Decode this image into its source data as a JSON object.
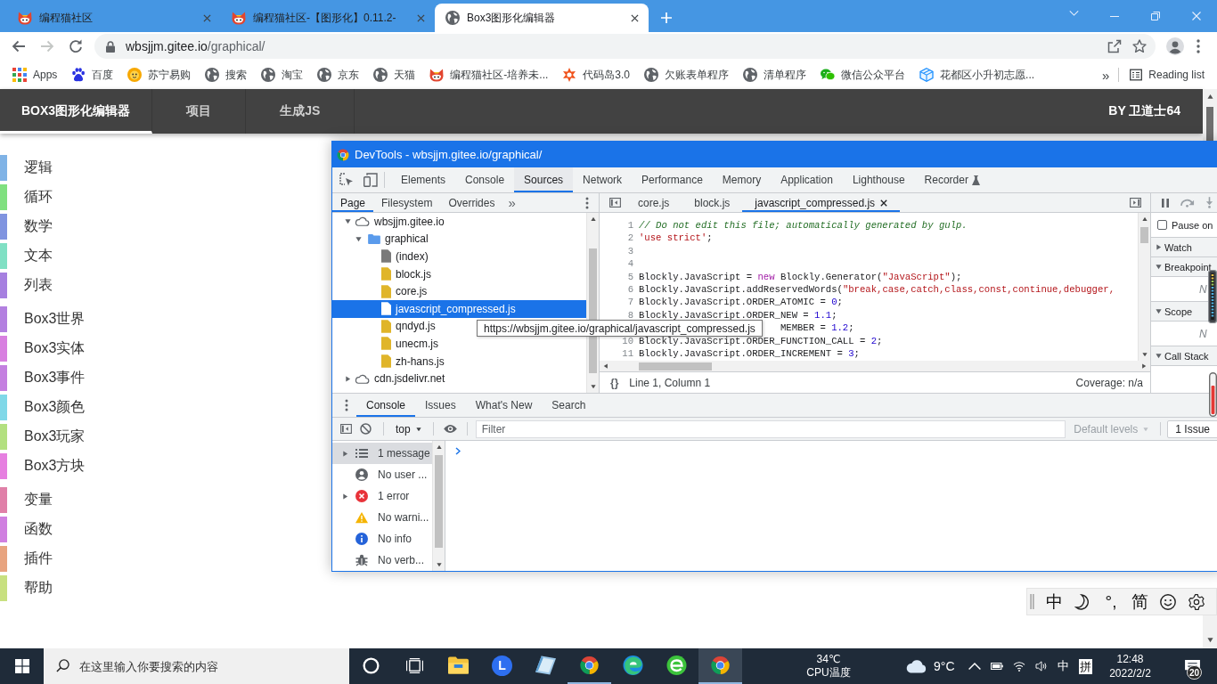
{
  "browser": {
    "tabs": [
      {
        "title": "编程猫社区",
        "kind": "cat",
        "selected": false
      },
      {
        "title": "编程猫社区-【图形化】0.11.2-",
        "kind": "cat",
        "selected": false
      },
      {
        "title": "Box3图形化编辑器",
        "kind": "globe",
        "selected": true
      }
    ],
    "forward_disabled": true,
    "url": {
      "host": "wbsjjm.gitee.io",
      "path": "/graphical/"
    },
    "bookmarks": [
      {
        "label": "Apps",
        "kind": "apps"
      },
      {
        "label": "百度",
        "kind": "paw"
      },
      {
        "label": "苏宁易购",
        "kind": "sun"
      },
      {
        "label": "搜索",
        "kind": "globe"
      },
      {
        "label": "淘宝",
        "kind": "globe"
      },
      {
        "label": "京东",
        "kind": "globe"
      },
      {
        "label": "天猫",
        "kind": "globe"
      },
      {
        "label": "编程猫社区-培养未...",
        "kind": "cat"
      },
      {
        "label": "代码岛3.0",
        "kind": "flower"
      },
      {
        "label": "欠账表单程序",
        "kind": "globe"
      },
      {
        "label": "清单程序",
        "kind": "globe"
      },
      {
        "label": "微信公众平台",
        "kind": "chat"
      },
      {
        "label": "花都区小升初志愿...",
        "kind": "cube"
      }
    ],
    "bookmarks_more": "»",
    "reading_list": "Reading list"
  },
  "page": {
    "nav": [
      {
        "label": "BOX3图形化编辑器",
        "selected": true
      },
      {
        "label": "项目",
        "selected": false
      },
      {
        "label": "生成JS",
        "selected": false
      }
    ],
    "author": "BY 卫道士64",
    "category_groups": [
      {
        "items": [
          {
            "label": "逻辑",
            "color": "#80b3e6"
          },
          {
            "label": "循环",
            "color": "#80e080"
          },
          {
            "label": "数学",
            "color": "#8094e0"
          },
          {
            "label": "文本",
            "color": "#80e0c4"
          },
          {
            "label": "列表",
            "color": "#a680e0"
          }
        ]
      },
      {
        "items": [
          {
            "label": "Box3世界",
            "color": "#b380e0"
          },
          {
            "label": "Box3实体",
            "color": "#d880e0"
          },
          {
            "label": "Box3事件",
            "color": "#c480e0"
          },
          {
            "label": "Box3颜色",
            "color": "#80d8e8"
          },
          {
            "label": "Box3玩家",
            "color": "#b3e080"
          },
          {
            "label": "Box3方块",
            "color": "#e680e0"
          }
        ]
      },
      {
        "items": [
          {
            "label": "变量",
            "color": "#e080a8"
          },
          {
            "label": "函数",
            "color": "#d080e0"
          },
          {
            "label": "插件",
            "color": "#e8a480"
          },
          {
            "label": "帮助",
            "color": "#c8e080"
          }
        ]
      }
    ]
  },
  "devtools": {
    "title": "DevTools - wbsjjm.gitee.io/graphical/",
    "panels": [
      {
        "label": "Elements",
        "selected": false,
        "experimental": false
      },
      {
        "label": "Console",
        "selected": false,
        "experimental": false
      },
      {
        "label": "Sources",
        "selected": true,
        "experimental": false
      },
      {
        "label": "Network",
        "selected": false,
        "experimental": false
      },
      {
        "label": "Performance",
        "selected": false,
        "experimental": false
      },
      {
        "label": "Memory",
        "selected": false,
        "experimental": false
      },
      {
        "label": "Application",
        "selected": false,
        "experimental": false
      },
      {
        "label": "Lighthouse",
        "selected": false,
        "experimental": false
      },
      {
        "label": "Recorder",
        "selected": false,
        "experimental": true
      }
    ],
    "navigator": {
      "tabs": [
        {
          "label": "Page",
          "selected": true
        },
        {
          "label": "Filesystem",
          "selected": false
        },
        {
          "label": "Overrides",
          "selected": false
        }
      ],
      "more": "»",
      "tree": [
        {
          "label": "wbsjjm.gitee.io",
          "kind": "domain",
          "expanded": true,
          "selected": false,
          "children": [
            {
              "label": "graphical",
              "kind": "folder",
              "expanded": true,
              "selected": false,
              "children": [
                {
                  "label": "(index)",
                  "kind": "document",
                  "selected": false
                },
                {
                  "label": "block.js",
                  "kind": "script",
                  "selected": false
                },
                {
                  "label": "core.js",
                  "kind": "script",
                  "selected": false
                },
                {
                  "label": "javascript_compressed.js",
                  "kind": "script",
                  "selected": true
                },
                {
                  "label": "qndyd.js",
                  "kind": "script",
                  "selected": false
                },
                {
                  "label": "unecm.js",
                  "kind": "script",
                  "selected": false
                },
                {
                  "label": "zh-hans.js",
                  "kind": "script",
                  "selected": false
                }
              ]
            }
          ]
        },
        {
          "label": "cdn.jsdelivr.net",
          "kind": "domain",
          "expanded": false,
          "selected": false
        }
      ],
      "tooltip": "https://wbsjjm.gitee.io/graphical/javascript_compressed.js"
    },
    "editor": {
      "tabs": [
        {
          "label": "core.js",
          "selected": false
        },
        {
          "label": "block.js",
          "selected": false
        },
        {
          "label": "javascript_compressed.js",
          "selected": true
        }
      ],
      "lines": [
        {
          "n": "1",
          "covered": false,
          "tokens": [
            {
              "kind": "comment",
              "text": "// Do not edit this file; automatically generated by gulp."
            }
          ]
        },
        {
          "n": "2",
          "covered": false,
          "tokens": [
            {
              "kind": "string",
              "text": "'use strict'"
            },
            {
              "kind": "plain",
              "text": ";"
            }
          ]
        },
        {
          "n": "3"
        },
        {
          "n": "4"
        },
        {
          "n": "5",
          "covered": false,
          "tokens": [
            {
              "kind": "plain",
              "text": "Blockly.JavaScript = "
            },
            {
              "kind": "keyword",
              "text": "new"
            },
            {
              "kind": "plain",
              "text": " Blockly.Generator("
            },
            {
              "kind": "string",
              "text": "\"JavaScript\""
            },
            {
              "kind": "plain",
              "text": ");"
            }
          ]
        },
        {
          "n": "6",
          "covered": false,
          "tokens": [
            {
              "kind": "plain",
              "text": "Blockly.JavaScript.addReservedWords("
            },
            {
              "kind": "string",
              "text": "\"break,case,catch,class,const,continue,debugger,"
            }
          ]
        },
        {
          "n": "7",
          "covered": false,
          "tokens": [
            {
              "kind": "plain",
              "text": "Blockly.JavaScript.ORDER_ATOMIC = "
            },
            {
              "kind": "number",
              "text": "0"
            },
            {
              "kind": "plain",
              "text": ";"
            }
          ]
        },
        {
          "n": "8",
          "covered": false,
          "tokens": [
            {
              "kind": "plain",
              "text": "Blockly.JavaScript.ORDER_NEW = "
            },
            {
              "kind": "number",
              "text": "1.1"
            },
            {
              "kind": "plain",
              "text": ";"
            }
          ]
        },
        {
          "covered": true,
          "tokens": [
            {
              "kind": "plain",
              "text": "MEMBER = "
            },
            {
              "kind": "number",
              "text": "1.2"
            },
            {
              "kind": "plain",
              "text": ";"
            }
          ]
        },
        {
          "n": "10",
          "covered": false,
          "tokens": [
            {
              "kind": "plain",
              "text": "Blockly.JavaScript.ORDER_FUNCTION_CALL = "
            },
            {
              "kind": "number",
              "text": "2"
            },
            {
              "kind": "plain",
              "text": ";"
            }
          ]
        },
        {
          "n": "11",
          "covered": false,
          "tokens": [
            {
              "kind": "plain",
              "text": "Blockly.JavaScript.ORDER_INCREMENT = "
            },
            {
              "kind": "number",
              "text": "3"
            },
            {
              "kind": "plain",
              "text": ";"
            }
          ]
        }
      ],
      "format": "{}",
      "position": "Line 1, Column 1",
      "coverage": "Coverage: n/a"
    },
    "debugger": {
      "pause_on": {
        "label": "Pause on",
        "checked": false
      },
      "sections": [
        {
          "label": "Watch",
          "expanded": false
        },
        {
          "label": "Breakpoint",
          "expanded": true,
          "message": "N"
        },
        {
          "label": "Scope",
          "expanded": true,
          "message": "N"
        },
        {
          "label": "Call Stack",
          "expanded": true
        }
      ]
    },
    "drawer": {
      "tabs": [
        {
          "label": "Console",
          "selected": true
        },
        {
          "label": "Issues",
          "selected": false
        },
        {
          "label": "What's New",
          "selected": false
        },
        {
          "label": "Search",
          "selected": false
        }
      ],
      "context": "top",
      "filter": {
        "placeholder": "Filter"
      },
      "levels": {
        "label": "Default levels",
        "disabled": true
      },
      "issues": "1 Issue",
      "sidebar": [
        {
          "label": "1 message",
          "kind": "messages",
          "expandable": true,
          "selected": true
        },
        {
          "label": "No user ...",
          "kind": "user",
          "expandable": false,
          "selected": false
        },
        {
          "label": "1 error",
          "kind": "error",
          "expandable": true,
          "selected": false
        },
        {
          "label": "No warni...",
          "kind": "warning",
          "expandable": false,
          "selected": false
        },
        {
          "label": "No info",
          "kind": "info",
          "expandable": false,
          "selected": false
        },
        {
          "label": "No verb...",
          "kind": "verbose",
          "expandable": false,
          "selected": false
        }
      ]
    }
  },
  "ime_bar": {
    "items": [
      {
        "kind": "text",
        "label": "中"
      },
      {
        "kind": "moon"
      },
      {
        "kind": "text",
        "label": "°,"
      },
      {
        "kind": "text",
        "label": "简"
      },
      {
        "kind": "smiley"
      },
      {
        "kind": "gear"
      }
    ]
  },
  "taskbar": {
    "search": {
      "placeholder": "在这里输入你要搜索的内容"
    },
    "apps": [
      {
        "kind": "cortana",
        "running": false,
        "active": false
      },
      {
        "kind": "task_view",
        "running": false,
        "active": false
      },
      {
        "kind": "explorer",
        "running": false,
        "active": false
      },
      {
        "kind": "letter",
        "label": "L",
        "running": false,
        "active": false
      },
      {
        "kind": "notes",
        "running": false,
        "active": false
      },
      {
        "kind": "chrome",
        "running": true,
        "active": false
      },
      {
        "kind": "edge",
        "running": false,
        "active": false
      },
      {
        "kind": "swirl",
        "running": false,
        "active": false
      },
      {
        "kind": "chrome",
        "running": true,
        "active": true
      }
    ],
    "cpu": {
      "temperature": "34℃",
      "label": "CPU温度"
    },
    "weather": "9°C",
    "ime": "中",
    "ime_mode": "拼",
    "clock": {
      "time": "12:48",
      "date": "2022/2/2"
    },
    "notifications": "20"
  }
}
